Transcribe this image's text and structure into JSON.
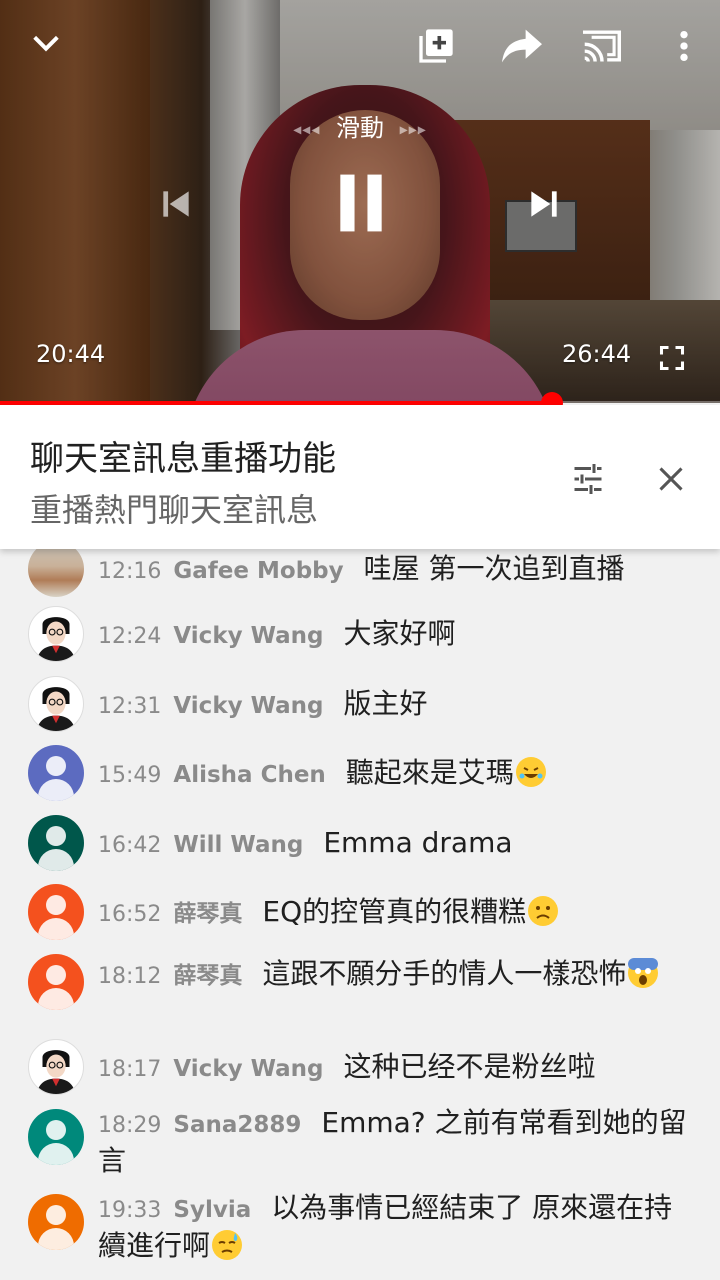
{
  "player": {
    "speed_label": "滑動",
    "time_current": "20:44",
    "time_total": "26:44",
    "progress_fraction": 0.766,
    "accent_color": "#ff0000"
  },
  "panel": {
    "title": "聊天室訊息重播功能",
    "subtitle": "重播熱門聊天室訊息"
  },
  "icons": {
    "collapse": "chevron-down-icon",
    "add_to_playlist": "add-to-playlist-icon",
    "share": "share-icon",
    "cast": "cast-icon",
    "more": "more-vert-icon",
    "previous": "skip-previous-icon",
    "pause": "pause-icon",
    "next": "skip-next-icon",
    "fullscreen": "fullscreen-icon",
    "filter": "tune-icon",
    "close": "close-icon"
  },
  "chat": {
    "messages": [
      {
        "time": "12:16",
        "author": "Gafee Mobby",
        "text": "哇屋 第一次追到直播",
        "avatar": "landscape"
      },
      {
        "time": "12:24",
        "author": "Vicky Wang",
        "text": "大家好啊",
        "avatar": "photo"
      },
      {
        "time": "12:31",
        "author": "Vicky Wang",
        "text": "版主好",
        "avatar": "photo"
      },
      {
        "time": "15:49",
        "author": "Alisha Chen",
        "text": "聽起來是艾瑪",
        "emoji": "rolling-laughing-emoji",
        "avatar": "#5c6bc0"
      },
      {
        "time": "16:42",
        "author": "Will Wang",
        "text": "Emma drama",
        "avatar": "#00574b"
      },
      {
        "time": "16:52",
        "author": "薛琴真",
        "text": "EQ的控管真的很糟糕",
        "emoji": "slightly-frowning-emoji",
        "avatar": "#f4511e"
      },
      {
        "time": "18:12",
        "author": "薛琴真",
        "text": "這跟不願分手的情人一樣恐怖",
        "emoji": "screaming-emoji",
        "avatar": "#f4511e"
      },
      {
        "time": "18:17",
        "author": "Vicky Wang",
        "text": "这种已经不是粉丝啦",
        "avatar": "photo"
      },
      {
        "time": "18:29",
        "author": "Sana2889",
        "text": "Emma? 之前有常看到她的留言",
        "avatar": "#00897b"
      },
      {
        "time": "19:33",
        "author": "Sylvia",
        "text": "以為事情已經結束了 原來還在持續進行啊",
        "emoji": "sweat-emoji",
        "avatar": "#ef6c00"
      }
    ]
  }
}
